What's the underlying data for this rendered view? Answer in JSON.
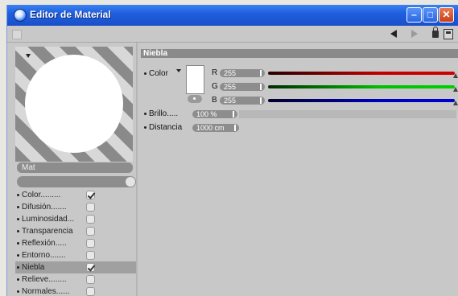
{
  "window": {
    "title": "Editor de Material"
  },
  "preview": {
    "material_name": "Mat"
  },
  "channels": [
    {
      "label": "Color",
      "dots": ".........",
      "checked": true
    },
    {
      "label": "Difusión",
      "dots": ".......",
      "checked": false
    },
    {
      "label": "Luminosidad",
      "dots": "...",
      "checked": false
    },
    {
      "label": "Transparencia",
      "dots": "",
      "checked": false
    },
    {
      "label": "Reflexión",
      "dots": ".....",
      "checked": false
    },
    {
      "label": "Entorno",
      "dots": ".......",
      "checked": false
    },
    {
      "label": "Niebla",
      "dots": "",
      "checked": true,
      "active": true
    },
    {
      "label": "Relieve",
      "dots": "........",
      "checked": false
    },
    {
      "label": "Normales",
      "dots": "......",
      "checked": false
    }
  ],
  "panel": {
    "section_title": "Niebla",
    "color_label": "Color",
    "r_label": "R",
    "g_label": "G",
    "b_label": "B",
    "r_value": "255",
    "g_value": "255",
    "b_value": "255",
    "brillo_label": "Brillo",
    "brillo_dots": ".....",
    "brillo_value": "100 %",
    "distancia_label": "Distancia",
    "distancia_value": "1000 cm"
  },
  "colors": {
    "titlebar": "#1f5fe0",
    "fog_color": "#ffffff",
    "red_track": "#c00000",
    "green_track": "#00c000",
    "blue_track": "#0000c0"
  }
}
